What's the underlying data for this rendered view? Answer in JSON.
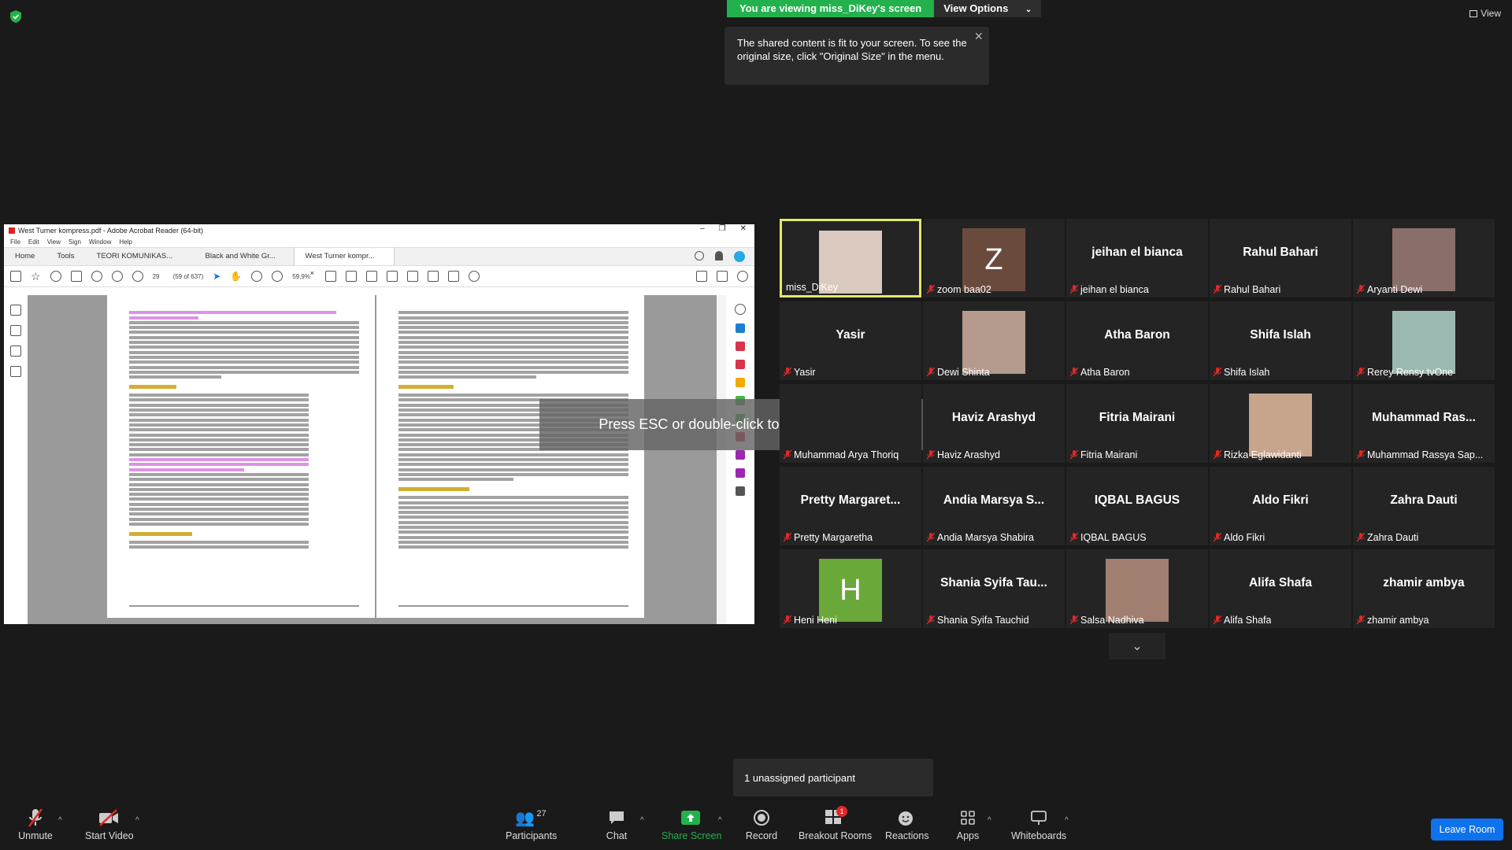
{
  "topbar": {
    "viewing_label": "You are viewing miss_DiKey's screen",
    "view_options_label": "View Options",
    "view_right_label": "View"
  },
  "tooltip": {
    "text": "The shared content is fit to your screen. To see the original size, click \"Original Size\" in the menu."
  },
  "overlay": {
    "esc_text": "Press ESC or double-click to exit full screen mode"
  },
  "acrobat": {
    "title": "West Turner kompress.pdf - Adobe Acrobat Reader (64-bit)",
    "menu": [
      "File",
      "Edit",
      "View",
      "Sign",
      "Window",
      "Help"
    ],
    "tabs": [
      "Home",
      "Tools",
      "TEORI KOMUNIKAS...",
      "Black and White Gr...",
      "West Turner kompr..."
    ],
    "page_number": "29",
    "page_of": "(59 of 637)",
    "zoom": "59,9%"
  },
  "participants": [
    {
      "name": "miss_DiKey",
      "display": "",
      "label": "miss_DiKey",
      "muted": false,
      "active": true,
      "avatar": "photo",
      "photo_color": "#d9c9be"
    },
    {
      "name": "zoom baa02",
      "display": "",
      "label": "zoom baa02",
      "muted": true,
      "active": false,
      "avatar": "letter",
      "letter": "Z",
      "letter_bg": "#6b4a3e"
    },
    {
      "name": "jeihan el bianca",
      "display": "jeihan el bianca",
      "label": "jeihan el bianca",
      "muted": true
    },
    {
      "name": "Rahul Bahari",
      "display": "Rahul Bahari",
      "label": "Rahul Bahari",
      "muted": true
    },
    {
      "name": "Aryanti Dewi",
      "display": "",
      "label": "Aryanti Dewi",
      "muted": true,
      "avatar": "photo",
      "photo_color": "#8a6e6a"
    },
    {
      "name": "Yasir",
      "display": "Yasir",
      "label": "Yasir",
      "muted": true
    },
    {
      "name": "Dewi Shinta",
      "display": "",
      "label": "Dewi Shinta",
      "muted": true,
      "avatar": "photo",
      "photo_color": "#b39a8c"
    },
    {
      "name": "Atha Baron",
      "display": "Atha Baron",
      "label": "Atha Baron",
      "muted": true
    },
    {
      "name": "Shifa Islah",
      "display": "Shifa Islah",
      "label": "Shifa Islah",
      "muted": true
    },
    {
      "name": "Rerey Rensy tvOne",
      "display": "",
      "label": "Rerey Rensy tvOne",
      "muted": true,
      "avatar": "photo",
      "photo_color": "#9bb9b0"
    },
    {
      "name": "Muhammad Arya Thoriq",
      "display": "",
      "label": "Muhammad Arya Thoriq",
      "muted": true
    },
    {
      "name": "Haviz Arashyd",
      "display": "Haviz Arashyd",
      "label": "Haviz Arashyd",
      "muted": true
    },
    {
      "name": "Fitria Mairani",
      "display": "Fitria Mairani",
      "label": "Fitria Mairani",
      "muted": true
    },
    {
      "name": "Rizka Eglawidanti",
      "display": "",
      "label": "Rizka Eglawidanti",
      "muted": true,
      "avatar": "photo",
      "photo_color": "#c7a48c"
    },
    {
      "name": "Muhammad Rassya Sap...",
      "display": "Muhammad Ras...",
      "label": "Muhammad Rassya Sap...",
      "muted": true
    },
    {
      "name": "Pretty Margaretha",
      "display": "Pretty Margaret...",
      "label": "Pretty Margaretha",
      "muted": true
    },
    {
      "name": "Andia Marsya Shabira",
      "display": "Andia Marsya S...",
      "label": "Andia Marsya Shabira",
      "muted": true
    },
    {
      "name": "IQBAL BAGUS",
      "display": "IQBAL BAGUS",
      "label": "IQBAL BAGUS",
      "muted": true
    },
    {
      "name": "Aldo Fikri",
      "display": "Aldo Fikri",
      "label": "Aldo Fikri",
      "muted": true
    },
    {
      "name": "Zahra Dauti",
      "display": "Zahra Dauti",
      "label": "Zahra Dauti",
      "muted": true
    },
    {
      "name": "Heni Heni",
      "display": "",
      "label": "Heni Heni",
      "muted": true,
      "avatar": "letter",
      "letter": "H",
      "letter_bg": "#6aa83a"
    },
    {
      "name": "Shania Syifa Tauchid",
      "display": "Shania Syifa Tau...",
      "label": "Shania Syifa Tauchid",
      "muted": true
    },
    {
      "name": "Salsa Nadhiva",
      "display": "",
      "label": "Salsa Nadhiva",
      "muted": true,
      "avatar": "photo",
      "photo_color": "#a07f70"
    },
    {
      "name": "Alifa Shafa",
      "display": "Alifa Shafa",
      "label": "Alifa Shafa",
      "muted": true
    },
    {
      "name": "zhamir ambya",
      "display": "zhamir ambya",
      "label": "zhamir ambya",
      "muted": true
    }
  ],
  "unassigned": {
    "text": "1 unassigned participant"
  },
  "toolbar": {
    "unmute": "Unmute",
    "start_video": "Start Video",
    "participants": "Participants",
    "participants_count": "27",
    "chat": "Chat",
    "share_screen": "Share Screen",
    "record": "Record",
    "breakout_rooms": "Breakout Rooms",
    "breakout_badge": "1",
    "reactions": "Reactions",
    "apps": "Apps",
    "whiteboards": "Whiteboards",
    "leave": "Leave Room"
  },
  "colors": {
    "share_green": "#23b14d",
    "active_border": "#e3e86b",
    "leave_blue": "#0e72ed",
    "mute_red": "#e02828"
  }
}
